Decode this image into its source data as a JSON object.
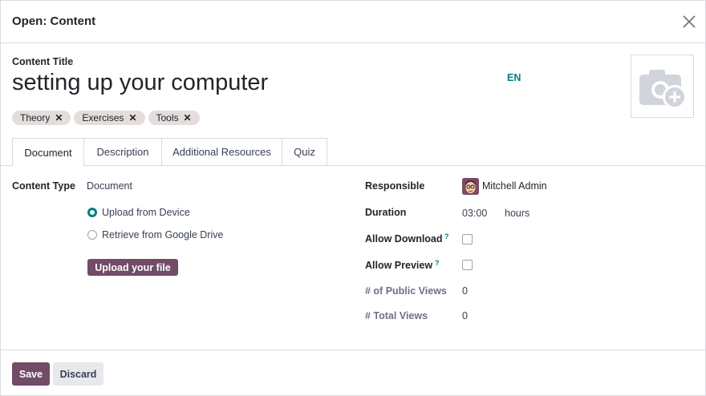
{
  "dialog": {
    "title": "Open: Content"
  },
  "form": {
    "title_label": "Content Title",
    "title_value": "setting up your computer",
    "language": "EN",
    "tags": [
      {
        "label": "Theory"
      },
      {
        "label": "Exercises"
      },
      {
        "label": "Tools"
      }
    ],
    "tag_remove_glyph": "✕"
  },
  "tabs": [
    {
      "label": "Document",
      "active": true
    },
    {
      "label": "Description",
      "active": false
    },
    {
      "label": "Additional Resources",
      "active": false
    },
    {
      "label": "Quiz",
      "active": false
    }
  ],
  "document": {
    "content_type_label": "Content Type",
    "content_type_value": "Document",
    "source_options": [
      {
        "label": "Upload from Device",
        "selected": true
      },
      {
        "label": "Retrieve from Google Drive",
        "selected": false
      }
    ],
    "upload_button": "Upload your file"
  },
  "details": {
    "responsible_label": "Responsible",
    "responsible_value": "Mitchell Admin",
    "duration_label": "Duration",
    "duration_value": "03:00",
    "duration_unit": "hours",
    "allow_download_label": "Allow Download",
    "allow_download_checked": false,
    "allow_preview_label": "Allow Preview",
    "allow_preview_checked": false,
    "help_mark": "?",
    "public_views_label": "# of Public Views",
    "public_views_value": "0",
    "total_views_label": "# Total Views",
    "total_views_value": "0"
  },
  "footer": {
    "save": "Save",
    "discard": "Discard"
  },
  "colors": {
    "primary": "#714b67",
    "accent": "#017e84",
    "tag_bg": "#e5dcdc"
  },
  "icons": {
    "close": "close-icon",
    "image_placeholder": "camera-add-icon",
    "avatar": "user-avatar"
  }
}
